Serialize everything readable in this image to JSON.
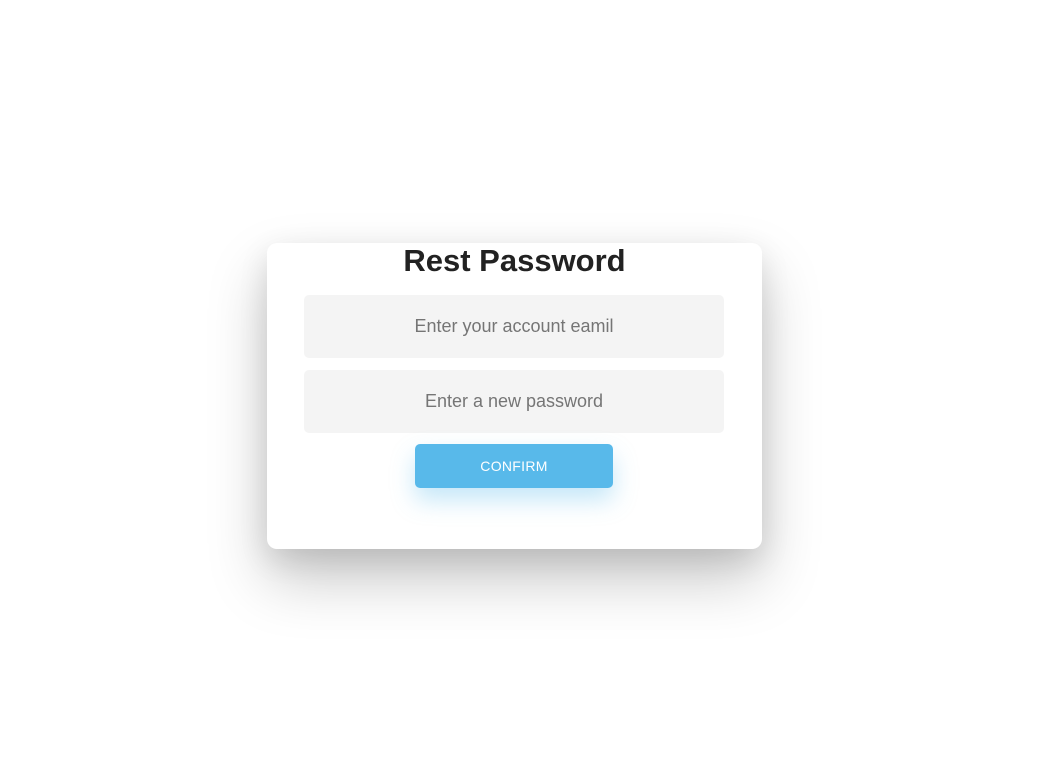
{
  "reset_form": {
    "title": "Rest Password",
    "email_field": {
      "placeholder": "Enter your account eamil",
      "value": ""
    },
    "password_field": {
      "placeholder": "Enter a new password",
      "value": ""
    },
    "confirm_label": "CONFIRM"
  },
  "colors": {
    "accent": "#58b9ea",
    "field_background": "#f4f4f4",
    "title_text": "#222222"
  }
}
